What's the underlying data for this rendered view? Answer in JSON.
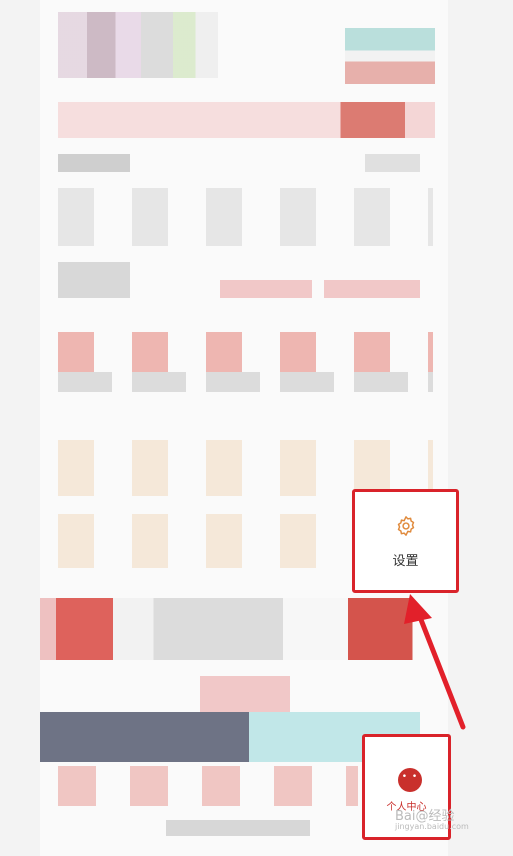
{
  "settings": {
    "label": "设置"
  },
  "profile": {
    "label": "个人中心",
    "avatar_face": "• •"
  },
  "watermark": {
    "text": "Bai@经验",
    "sub": "jingyan.baidu.com"
  },
  "colors": {
    "accent": "#d9232a",
    "avatar": "#c9302c",
    "settings_icon": "#e08a3c"
  },
  "icons": {
    "settings": "gear-icon",
    "profile": "avatar-icon",
    "annotation": "arrow-icon"
  }
}
